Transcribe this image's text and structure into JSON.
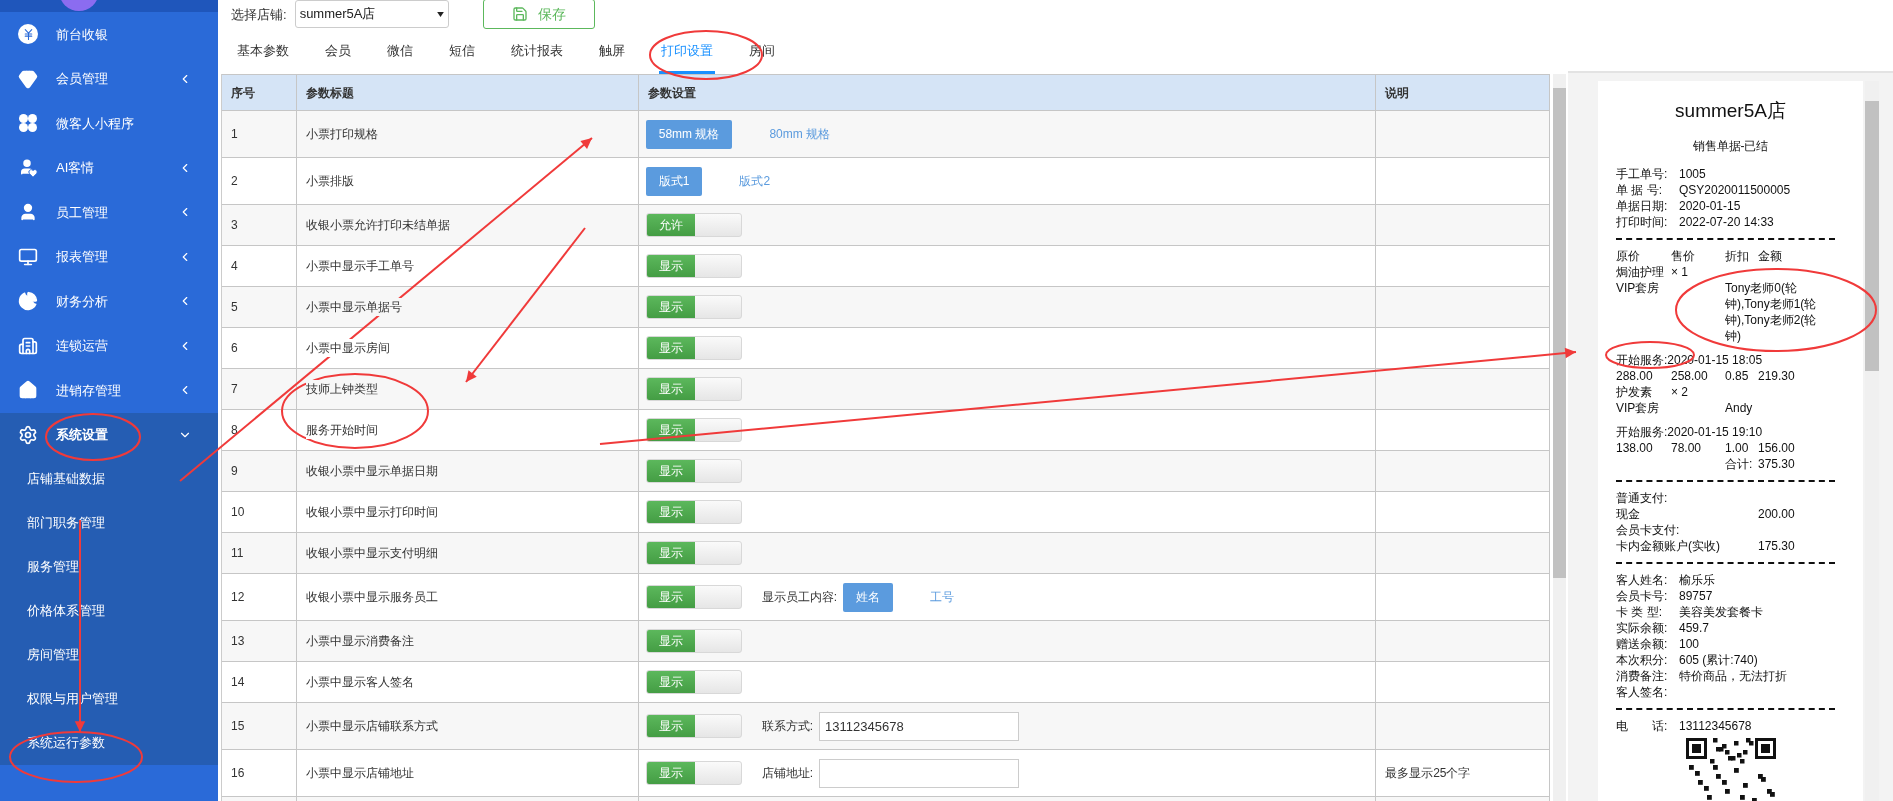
{
  "sidebar": {
    "items": [
      {
        "label": "前台收银",
        "kind": "yen",
        "expanded": false,
        "has_children": false
      },
      {
        "label": "会员管理",
        "kind": "gem",
        "expanded": false,
        "has_children": true
      },
      {
        "label": "微客人小程序",
        "kind": "clover",
        "expanded": false,
        "has_children": false
      },
      {
        "label": "AI客情",
        "kind": "userheart",
        "expanded": false,
        "has_children": true
      },
      {
        "label": "员工管理",
        "kind": "user",
        "expanded": false,
        "has_children": true
      },
      {
        "label": "报表管理",
        "kind": "monitor",
        "expanded": false,
        "has_children": true
      },
      {
        "label": "财务分析",
        "kind": "pie",
        "expanded": false,
        "has_children": true
      },
      {
        "label": "连锁运营",
        "kind": "building",
        "expanded": false,
        "has_children": true
      },
      {
        "label": "进销存管理",
        "kind": "house",
        "expanded": false,
        "has_children": true
      },
      {
        "label": "系统设置",
        "kind": "gear",
        "expanded": true,
        "has_children": true,
        "children": [
          {
            "label": "店铺基础数据"
          },
          {
            "label": "部门职务管理"
          },
          {
            "label": "服务管理"
          },
          {
            "label": "价格体系管理"
          },
          {
            "label": "房间管理"
          },
          {
            "label": "权限与用户管理"
          },
          {
            "label": "系统运行参数"
          }
        ]
      }
    ]
  },
  "toolbar": {
    "store_label": "选择店铺:",
    "store_value": "summer5A店",
    "save_label": "保存"
  },
  "tabs": [
    {
      "label": "基本参数",
      "selected": false
    },
    {
      "label": "会员",
      "selected": false
    },
    {
      "label": "微信",
      "selected": false
    },
    {
      "label": "短信",
      "selected": false
    },
    {
      "label": "统计报表",
      "selected": false
    },
    {
      "label": "触屏",
      "selected": false
    },
    {
      "label": "打印设置",
      "selected": true
    },
    {
      "label": "房间",
      "selected": false
    }
  ],
  "table": {
    "columns": [
      "序号",
      "参数标题",
      "参数设置",
      "说明"
    ],
    "rows": [
      {
        "no": "1",
        "title": "小票打印规格",
        "control": {
          "kind": "choice",
          "options": [
            {
              "label": "58mm 规格",
              "selected": true
            },
            {
              "label": "80mm 规格",
              "selected": false
            }
          ]
        }
      },
      {
        "no": "2",
        "title": "小票排版",
        "control": {
          "kind": "choice",
          "options": [
            {
              "label": "版式1",
              "selected": true
            },
            {
              "label": "版式2",
              "selected": false
            }
          ]
        }
      },
      {
        "no": "3",
        "title": "收银小票允许打印未结单据",
        "control": {
          "kind": "switch",
          "label": "允许",
          "on": true
        }
      },
      {
        "no": "4",
        "title": "小票中显示手工单号",
        "control": {
          "kind": "switch",
          "label": "显示",
          "on": true
        }
      },
      {
        "no": "5",
        "title": "小票中显示单据号",
        "control": {
          "kind": "switch",
          "label": "显示",
          "on": true
        }
      },
      {
        "no": "6",
        "title": "小票中显示房间",
        "control": {
          "kind": "switch",
          "label": "显示",
          "on": true
        }
      },
      {
        "no": "7",
        "title": "技师上钟类型",
        "control": {
          "kind": "switch",
          "label": "显示",
          "on": true
        }
      },
      {
        "no": "8",
        "title": "服务开始时间",
        "control": {
          "kind": "switch",
          "label": "显示",
          "on": true
        }
      },
      {
        "no": "9",
        "title": "收银小票中显示单据日期",
        "control": {
          "kind": "switch",
          "label": "显示",
          "on": true
        }
      },
      {
        "no": "10",
        "title": "收银小票中显示打印时间",
        "control": {
          "kind": "switch",
          "label": "显示",
          "on": true
        }
      },
      {
        "no": "11",
        "title": "收银小票中显示支付明细",
        "control": {
          "kind": "switch",
          "label": "显示",
          "on": true
        }
      },
      {
        "no": "12",
        "title": "收银小票中显示服务员工",
        "control": {
          "kind": "switch",
          "label": "显示",
          "on": true
        },
        "extra": {
          "kind": "choice",
          "label": "显示员工内容:",
          "options": [
            {
              "label": "姓名",
              "selected": true
            },
            {
              "label": "工号",
              "selected": false
            }
          ]
        }
      },
      {
        "no": "13",
        "title": "小票中显示消费备注",
        "control": {
          "kind": "switch",
          "label": "显示",
          "on": true
        }
      },
      {
        "no": "14",
        "title": "小票中显示客人签名",
        "control": {
          "kind": "switch",
          "label": "显示",
          "on": true
        }
      },
      {
        "no": "15",
        "title": "小票中显示店铺联系方式",
        "control": {
          "kind": "switch",
          "label": "显示",
          "on": true
        },
        "extra": {
          "kind": "input",
          "label": "联系方式:",
          "value": "13112345678"
        }
      },
      {
        "no": "16",
        "title": "小票中显示店铺地址",
        "control": {
          "kind": "switch",
          "label": "显示",
          "on": true
        },
        "extra": {
          "kind": "input",
          "label": "店铺地址:"
        },
        "note": "最多显示25个字"
      }
    ]
  },
  "receipt": {
    "title": "summer5A店",
    "subtitle": "销售单据-已结",
    "lines": [
      {
        "kind": "field",
        "label": "手工单号:",
        "value": "1005"
      },
      {
        "kind": "field",
        "label": "单 据 号:",
        "value": "QSY2020011500005"
      },
      {
        "kind": "field",
        "label": "单据日期:",
        "value": "2020-01-15"
      },
      {
        "kind": "field",
        "label": "打印时间:",
        "value": "2022-07-20 14:33"
      },
      {
        "kind": "sep"
      },
      {
        "kind": "cols",
        "cells": [
          "原价",
          "售价",
          "折扣",
          "金额"
        ]
      },
      {
        "kind": "cols",
        "cells": [
          "焗油护理",
          "× 1"
        ]
      },
      {
        "kind": "staff",
        "name": "VIP套房",
        "value": "Tony老师0(轮钟),Tony老师1(轮钟),Tony老师2(轮钟)"
      },
      {
        "kind": "inline",
        "label": "开始服务:",
        "value": "2020-01-15 18:05"
      },
      {
        "kind": "cols",
        "cells": [
          "288.00",
          "258.00",
          "0.85",
          "219.30"
        ]
      },
      {
        "kind": "cols",
        "cells": [
          "护发素",
          "× 2"
        ]
      },
      {
        "kind": "staff",
        "name": "VIP套房",
        "value": "Andy"
      },
      {
        "kind": "inline",
        "label": "开始服务:",
        "value": "2020-01-15 19:10"
      },
      {
        "kind": "cols",
        "cells": [
          "138.00",
          "78.00",
          "1.00",
          "156.00"
        ]
      },
      {
        "kind": "total",
        "label": "合计:",
        "value": "375.30"
      },
      {
        "kind": "sep"
      },
      {
        "kind": "text",
        "value": "普通支付:"
      },
      {
        "kind": "pay",
        "label": "现金",
        "value": "200.00"
      },
      {
        "kind": "text",
        "value": "会员卡支付:"
      },
      {
        "kind": "pay",
        "label": "卡内金额账户(实收)",
        "value": "175.30"
      },
      {
        "kind": "sep"
      },
      {
        "kind": "field",
        "label": "客人姓名:",
        "value": "榆乐乐"
      },
      {
        "kind": "field",
        "label": "会员卡号:",
        "value": "89757"
      },
      {
        "kind": "field",
        "label": "卡 类 型:",
        "value": "美容美发套餐卡"
      },
      {
        "kind": "field",
        "label": "实际余额:",
        "value": "459.7"
      },
      {
        "kind": "field",
        "label": "赠送余额:",
        "value": "100"
      },
      {
        "kind": "field",
        "label": "本次积分:",
        "value": "605 (累计:740)"
      },
      {
        "kind": "field",
        "label": "消费备注:",
        "value": "特价商品，无法打折"
      },
      {
        "kind": "field",
        "label": "客人签名:"
      },
      {
        "kind": "gap"
      },
      {
        "kind": "sep"
      },
      {
        "kind": "field",
        "label": "电　　话:",
        "value": "13112345678"
      },
      {
        "kind": "qr"
      }
    ]
  }
}
